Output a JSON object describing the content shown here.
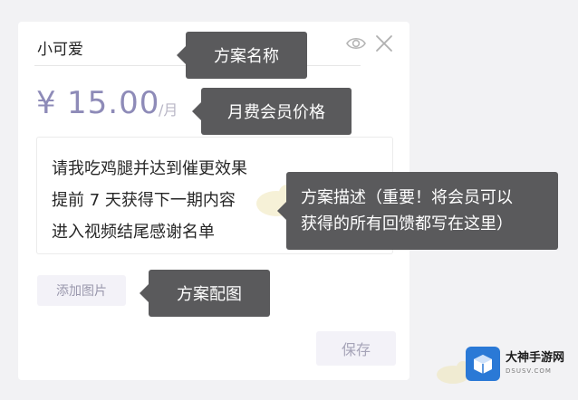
{
  "plan": {
    "name": "小可爱",
    "price_currency": "¥",
    "price_value": "15.00",
    "price_unit": "/月",
    "description_lines": [
      "请我吃鸡腿并达到催更效果",
      "提前 7 天获得下一期内容",
      "进入视频结尾感谢名单"
    ],
    "add_image_label": "添加图片",
    "save_label": "保存"
  },
  "tooltips": {
    "name": "方案名称",
    "price": "月费会员价格",
    "description_line1": "方案描述（重要！将会员可以",
    "description_line2": "获得的所有回馈都写在这里）",
    "image": "方案配图"
  },
  "icons": {
    "eye": "eye-icon",
    "close": "close-icon"
  },
  "watermark": {
    "title": "大神手游网",
    "url": "DSUSV.COM"
  },
  "colors": {
    "price": "#8e8bb8",
    "tooltip_bg": "#5a5a5c",
    "button_bg": "#f3f2f8",
    "logo": "#2a79d6"
  }
}
